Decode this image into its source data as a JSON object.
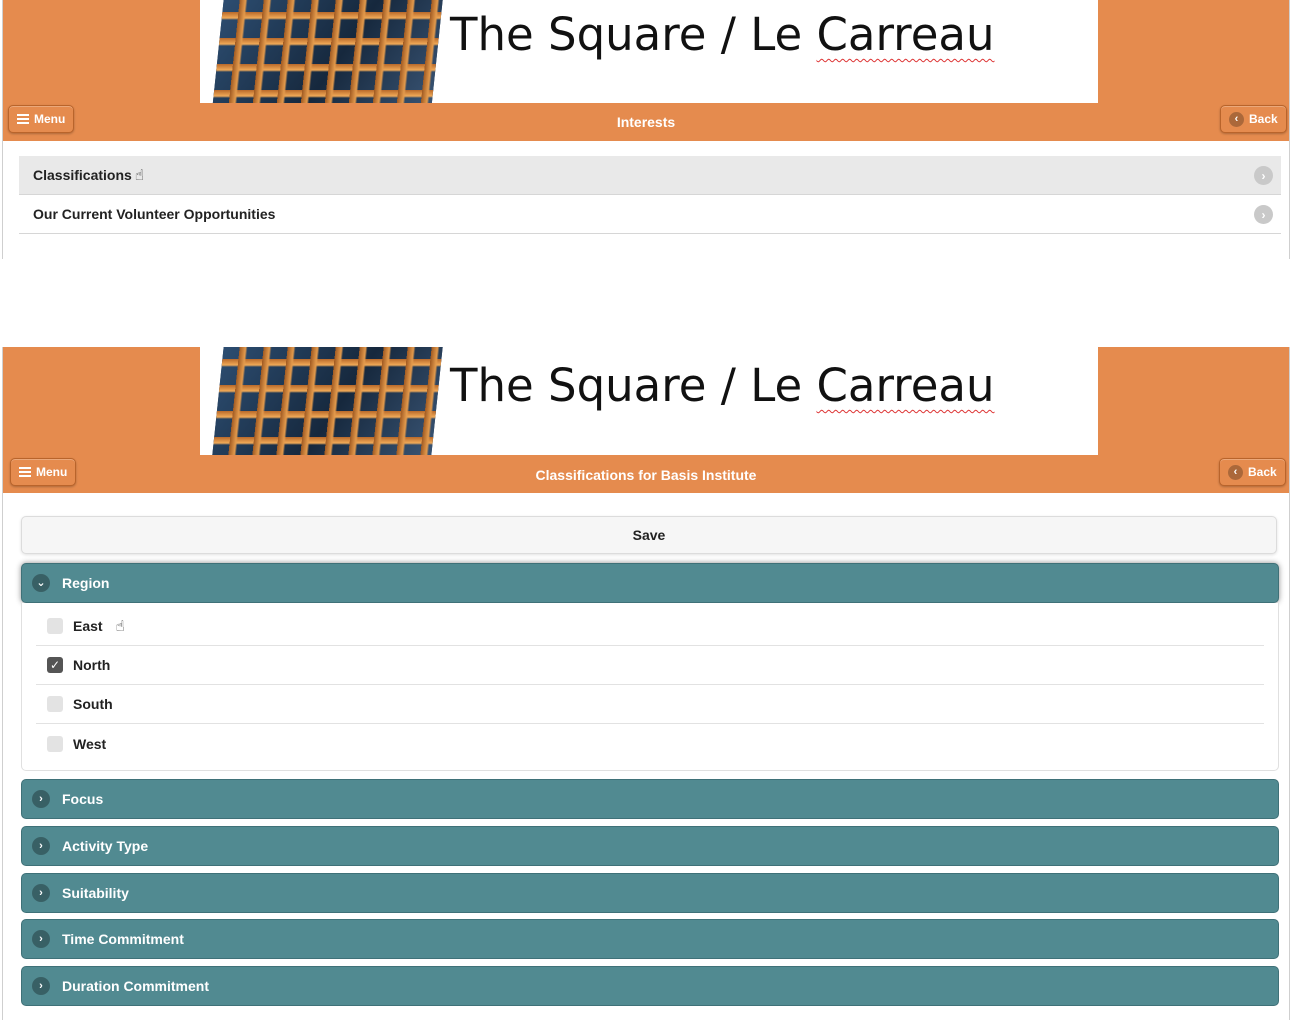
{
  "banner": {
    "title_prefix": "The Square / Le ",
    "title_word": "Carreau"
  },
  "header_buttons": {
    "menu": "Menu",
    "back": "Back"
  },
  "screen1": {
    "title": "Interests",
    "items": [
      {
        "label": "Classifications"
      },
      {
        "label": "Our Current Volunteer Opportunities"
      }
    ]
  },
  "screen2": {
    "title": "Classifications for Basis Institute",
    "save_label": "Save",
    "sections": [
      {
        "label": "Region",
        "expanded": true,
        "options": [
          {
            "label": "East",
            "checked": false
          },
          {
            "label": "North",
            "checked": true
          },
          {
            "label": "South",
            "checked": false
          },
          {
            "label": "West",
            "checked": false
          }
        ]
      },
      {
        "label": "Focus",
        "expanded": false
      },
      {
        "label": "Activity Type",
        "expanded": false
      },
      {
        "label": "Suitability",
        "expanded": false
      },
      {
        "label": "Time Commitment",
        "expanded": false
      },
      {
        "label": "Duration Commitment",
        "expanded": false
      }
    ]
  },
  "icons": {
    "menu": "hamburger-icon",
    "back": "chevron-left-icon",
    "list_arrow": "chevron-right-circle-icon",
    "expanded": "chevron-down-icon",
    "collapsed": "chevron-right-icon",
    "checked": "checkmark-icon",
    "cursor": "hand-pointer-cursor-icon"
  },
  "colors": {
    "header_orange": "#e58b4e",
    "accordion_teal": "#518a91"
  }
}
